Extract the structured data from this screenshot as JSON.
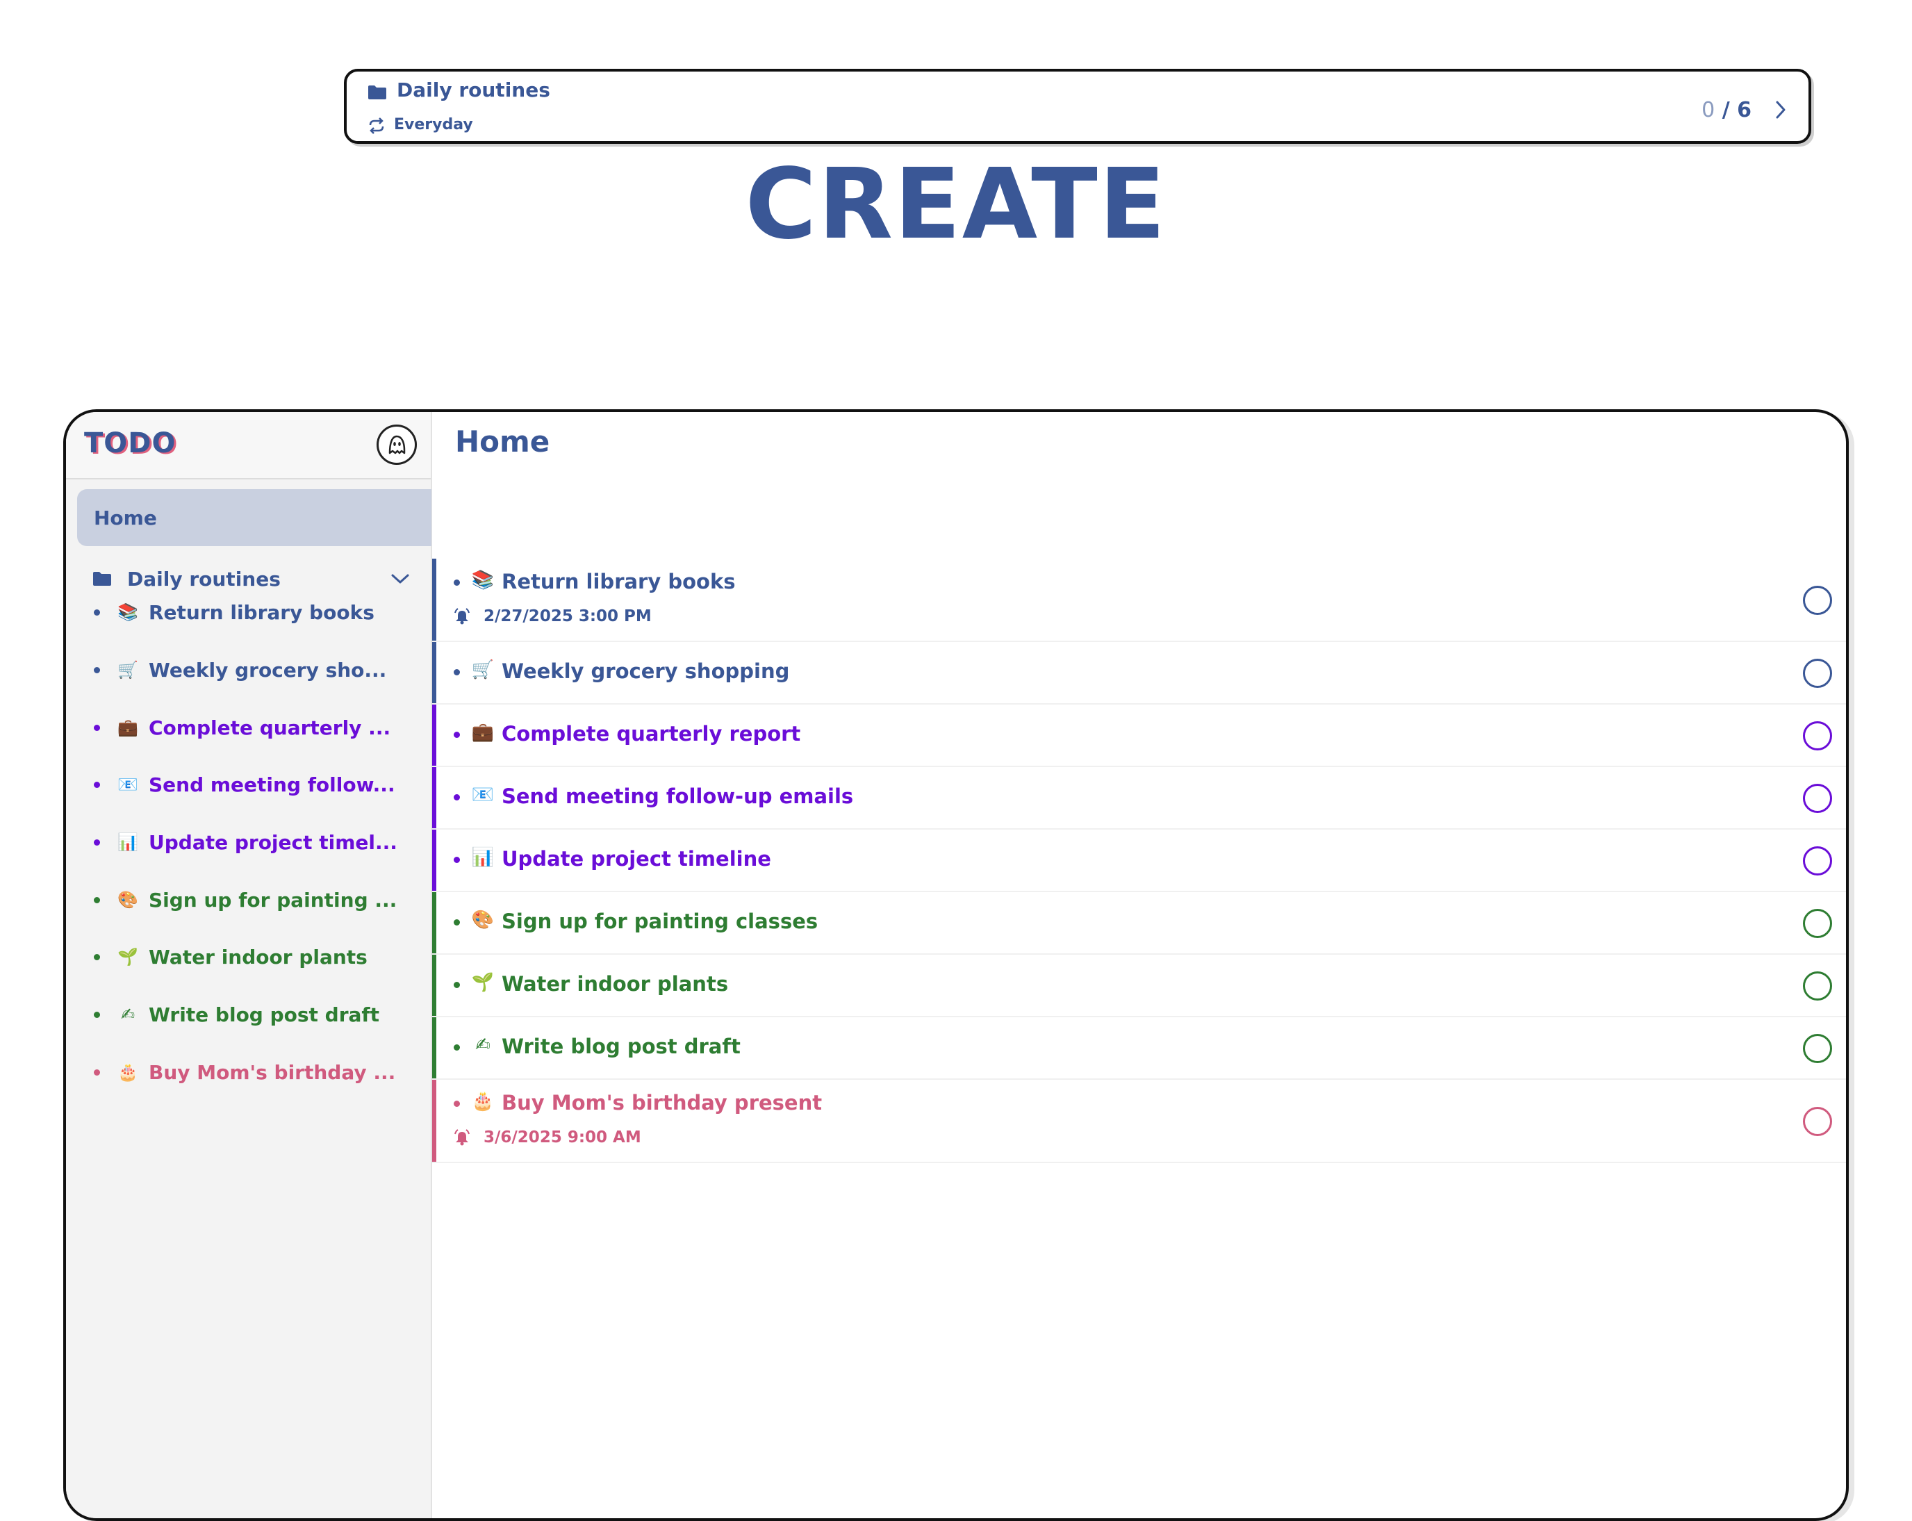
{
  "hero": {
    "title": "CREATE"
  },
  "colors": {
    "blue": "#3a5796",
    "purple": "#6a0dd8",
    "green": "#2e7d32",
    "pink": "#d05a7e"
  },
  "sidebar": {
    "logo": "TODO",
    "home_label": "Home",
    "folder_label": "Daily routines",
    "items": [
      {
        "emoji": "📚",
        "label": "Return library books",
        "color": "#3a5796"
      },
      {
        "emoji": "🛒",
        "label": "Weekly grocery sho...",
        "color": "#3a5796"
      },
      {
        "emoji": "💼",
        "label": "Complete quarterly ...",
        "color": "#6a0dd8"
      },
      {
        "emoji": "📧",
        "label": "Send meeting follow...",
        "color": "#6a0dd8"
      },
      {
        "emoji": "📊",
        "label": "Update project timel...",
        "color": "#6a0dd8"
      },
      {
        "emoji": "🎨",
        "label": "Sign up for painting ...",
        "color": "#2e7d32"
      },
      {
        "emoji": "🌱",
        "label": "Water indoor plants",
        "color": "#2e7d32"
      },
      {
        "emoji": "✍",
        "label": "Write blog post draft",
        "color": "#2e7d32"
      },
      {
        "emoji": "🎂",
        "label": "Buy Mom's birthday ...",
        "color": "#d05a7e"
      }
    ]
  },
  "main": {
    "title": "Home",
    "group": {
      "title": "Daily routines",
      "repeat": "Everyday",
      "done": "0",
      "total": "/ 6"
    },
    "tasks": [
      {
        "emoji": "📚",
        "label": "Return library books",
        "date": "2/27/2025 3:00 PM",
        "color": "#3a5796"
      },
      {
        "emoji": "🛒",
        "label": "Weekly grocery shopping",
        "date": "",
        "color": "#3a5796"
      },
      {
        "emoji": "💼",
        "label": "Complete quarterly report",
        "date": "",
        "color": "#6a0dd8"
      },
      {
        "emoji": "📧",
        "label": "Send meeting follow-up emails",
        "date": "",
        "color": "#6a0dd8"
      },
      {
        "emoji": "📊",
        "label": "Update project timeline",
        "date": "",
        "color": "#6a0dd8"
      },
      {
        "emoji": "🎨",
        "label": "Sign up for painting classes",
        "date": "",
        "color": "#2e7d32"
      },
      {
        "emoji": "🌱",
        "label": "Water indoor plants",
        "date": "",
        "color": "#2e7d32"
      },
      {
        "emoji": "✍",
        "label": "Write blog post draft",
        "date": "",
        "color": "#2e7d32"
      },
      {
        "emoji": "🎂",
        "label": "Buy Mom's birthday present",
        "date": "3/6/2025 9:00 AM",
        "color": "#d05a7e"
      }
    ]
  }
}
